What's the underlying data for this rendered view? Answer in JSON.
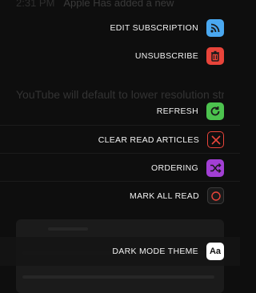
{
  "background": {
    "time": "2:31 PM",
    "headline": "Apple Has added a new",
    "body_text": "YouTube will default to lower resolution stream"
  },
  "menu": [
    {
      "label": "EDIT SUBSCRIPTION",
      "icon": "rss-icon",
      "color": "#4aa8f0"
    },
    {
      "label": "UNSUBSCRIBE",
      "icon": "trash-icon",
      "color": "#e8443a"
    },
    {
      "label": "REFRESH",
      "icon": "refresh-icon",
      "color": "#4cc24e"
    },
    {
      "label": "CLEAR READ ARTICLES",
      "icon": "x-icon",
      "color": "#e8443a"
    },
    {
      "label": "ORDERING",
      "icon": "shuffle-icon",
      "color": "#a23fd4"
    },
    {
      "label": "MARK ALL READ",
      "icon": "circle-icon",
      "color": "#e8443a"
    },
    {
      "label": "DARK MODE THEME",
      "icon": "font-icon",
      "icon_text": "Aa",
      "color": "#ffffff"
    }
  ]
}
